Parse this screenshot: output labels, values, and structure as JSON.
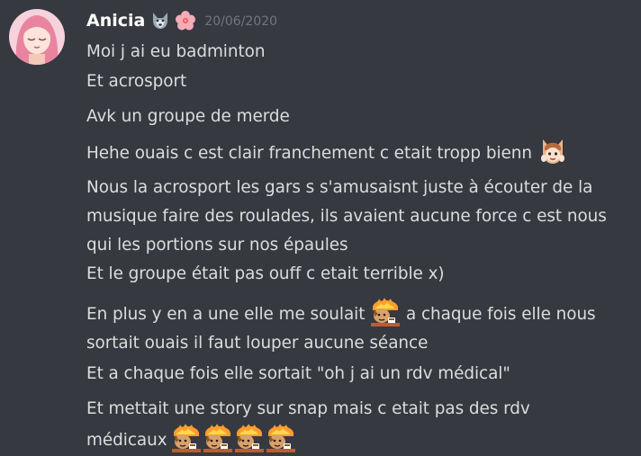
{
  "author": {
    "name": "Anicia",
    "badges": [
      "wolf-emoji",
      "hibiscus-emoji"
    ],
    "timestamp": "20/06/2020"
  },
  "messages": [
    {
      "lines": [
        "Moi j ai eu badminton"
      ]
    },
    {
      "lines": [
        "Et acrosport"
      ]
    },
    {
      "lines": [
        "Avk un groupe de merde"
      ]
    },
    {
      "lines": [
        "Hehe ouais c est clair franchement c etait tropp bienn"
      ],
      "trailing_emoji": "cat-girl-emoji"
    },
    {
      "lines": [
        "Nous la acrosport les gars s s'amusaisnt juste à écouter de la",
        "musique faire des roulades, ils avaient aucune force c est nous",
        "qui les portions sur nos épaules",
        "Et le groupe était pas ouff c etait terrible x)"
      ]
    },
    {
      "lines": [
        "En plus y en a une elle me soulait",
        "a chaque fois elle nous",
        "sortait ouais il faut louper aucune séance"
      ],
      "inline_emoji": "this-is-fine-dog-emoji"
    },
    {
      "lines": [
        "Et a chaque fois elle sortait \"oh j ai un rdv médical\""
      ]
    },
    {
      "lines": [
        "Et mettait une story sur snap mais c etait pas des rdv",
        "médicaux"
      ],
      "trailing_emojis": [
        "this-is-fine-dog-emoji",
        "this-is-fine-dog-emoji",
        "this-is-fine-dog-emoji",
        "this-is-fine-dog-emoji"
      ]
    }
  ]
}
